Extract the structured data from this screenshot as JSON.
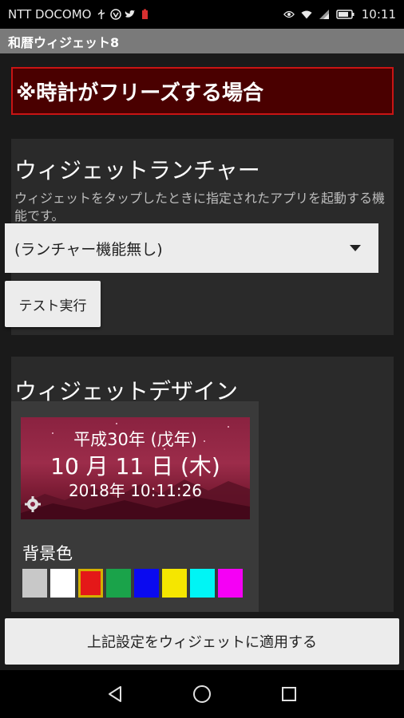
{
  "status_bar": {
    "carrier": "NTT DOCOMO",
    "time": "10:11"
  },
  "app": {
    "title": "和暦ウィジェット8"
  },
  "warning": {
    "text": "※時計がフリーズする場合"
  },
  "launcher": {
    "title": "ウィジェットランチャー",
    "description": "ウィジェットをタップしたときに指定されたアプリを起動する機能です。",
    "dropdown_value": "(ランチャー機能無し)",
    "test_button": "テスト実行"
  },
  "design": {
    "title": "ウィジェットデザイン",
    "preview": {
      "era_line": "平成30年 (戊年)",
      "date_line": "10 月 11 日 (木)",
      "datetime_line": "2018年 10:11:26"
    },
    "bg_label": "背景色",
    "swatches": [
      "#c8c8c8",
      "#ffffff",
      "#e41818",
      "#1aa34a",
      "#0a0af0",
      "#f5e600",
      "#00f5f5",
      "#f500f5"
    ],
    "selected_swatch_index": 2
  },
  "apply": {
    "button": "上記設定をウィジェットに適用する"
  },
  "colors": {
    "warning_bg": "#4a0000",
    "warning_border": "#c91414",
    "panel_bg": "#2a2a2a"
  }
}
